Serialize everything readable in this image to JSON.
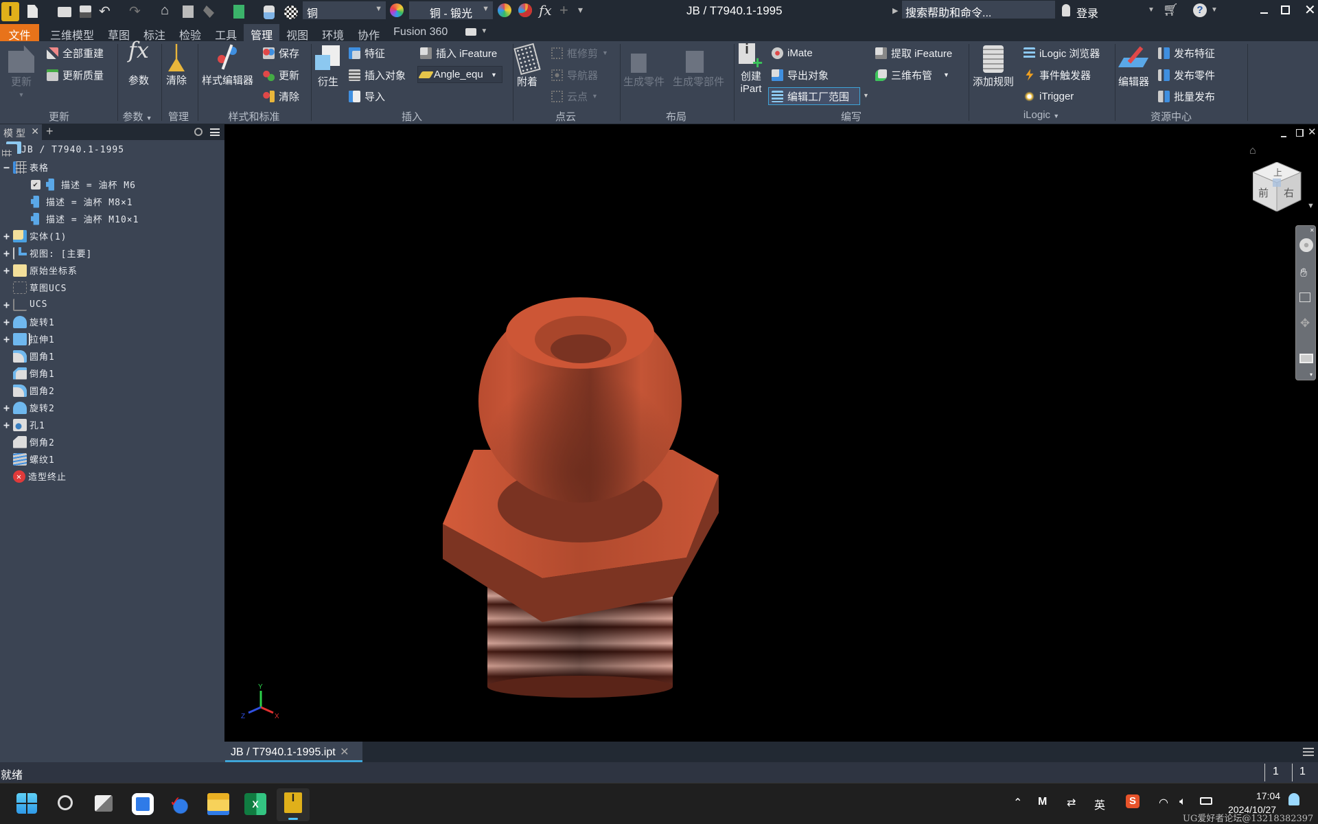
{
  "app": {
    "title": "JB / T7940.1-1995",
    "logo": "I"
  },
  "quick_access": {
    "material": "铜",
    "appearance": "铜 - 锻光",
    "fx": "fx",
    "search_placeholder": "搜索帮助和命令...",
    "sign_in": "登录"
  },
  "tabs": [
    {
      "label": "文件"
    },
    {
      "label": "三维模型"
    },
    {
      "label": "草图"
    },
    {
      "label": "标注"
    },
    {
      "label": "检验"
    },
    {
      "label": "工具"
    },
    {
      "label": "管理",
      "active": true
    },
    {
      "label": "视图"
    },
    {
      "label": "环境"
    },
    {
      "label": "协作"
    },
    {
      "label": "Fusion 360"
    }
  ],
  "ribbon": {
    "update": {
      "label": "更新",
      "update": "更新",
      "rebuild_all": "全部重建",
      "update_mass": "更新质量"
    },
    "params": {
      "label": "参数",
      "params": "参数",
      "fx": "fx"
    },
    "manage": {
      "label": "管理",
      "purge": "清除"
    },
    "styles": {
      "label": "样式和标准",
      "style_editor": "样式编辑器",
      "save": "保存",
      "update": "更新",
      "purge": "清除"
    },
    "insert": {
      "label": "插入",
      "derive": "衍生",
      "feature": "特征",
      "insert_object": "插入对象",
      "import": "导入",
      "insert_ifeature": "插入 iFeature",
      "angle_select": "Angle_equ"
    },
    "point_cloud": {
      "label": "点云",
      "attach": "附着",
      "box_trim": "框修剪",
      "navigator": "导航器",
      "cloud_points": "云点"
    },
    "layout": {
      "label": "布局",
      "make_part": "生成零件",
      "make_components": "生成零部件"
    },
    "author": {
      "label": "编写",
      "create_ipart_1": "创建",
      "create_ipart_2": "iPart",
      "imate": "iMate",
      "export_object": "导出对象",
      "edit_factory_scope": "编辑工厂范围",
      "extract_ifeature": "提取 iFeature",
      "tube_pipe": "三维布管"
    },
    "ilogic": {
      "label": "iLogic",
      "add_rule": "添加规则",
      "browser": "iLogic 浏览器",
      "event_trigger": "事件触发器",
      "itrigger": "iTrigger"
    },
    "content_center": {
      "label": "资源中心",
      "editor": "编辑器",
      "publish_feature": "发布特征",
      "publish_part": "发布零件",
      "batch_publish": "批量发布"
    }
  },
  "browser": {
    "tab": "模型",
    "root": "JB / T7940.1-1995",
    "items": [
      {
        "label": "表格",
        "expand": "−"
      },
      {
        "label": "描述 = 油杯 M6",
        "checked": true
      },
      {
        "label": "描述 = 油杯 M8×1"
      },
      {
        "label": "描述 = 油杯 M10×1"
      },
      {
        "label": "实体(1)",
        "expand": "+"
      },
      {
        "label": "视图: [主要]",
        "expand": "+"
      },
      {
        "label": "原始坐标系",
        "expand": "+"
      },
      {
        "label": "草图UCS"
      },
      {
        "label": "UCS",
        "expand": "+"
      },
      {
        "label": "旋转1",
        "expand": "+"
      },
      {
        "label": "拉伸1",
        "expand": "+"
      },
      {
        "label": "圆角1"
      },
      {
        "label": "倒角1"
      },
      {
        "label": "圆角2"
      },
      {
        "label": "旋转2",
        "expand": "+"
      },
      {
        "label": "孔1",
        "expand": "+"
      },
      {
        "label": "倒角2"
      },
      {
        "label": "螺纹1"
      },
      {
        "label": "造型终止"
      }
    ]
  },
  "viewcube": {
    "top": "上",
    "front": "前",
    "right": "右"
  },
  "triad": {
    "x": "X",
    "y": "Y",
    "z": "Z"
  },
  "document_tab": "JB / T7940.1-1995.ipt",
  "status": {
    "text": "就绪",
    "count1": "1",
    "count2": "1"
  },
  "taskbar": {
    "ime": "英",
    "time": "17:04",
    "date": "2024/10/27"
  },
  "watermark": "UG爱好者论坛@13218382397",
  "colors": {
    "accent_file_tab": "#e8731a",
    "active_tab_underline": "#3ea5d8",
    "copper": "#c65436"
  }
}
